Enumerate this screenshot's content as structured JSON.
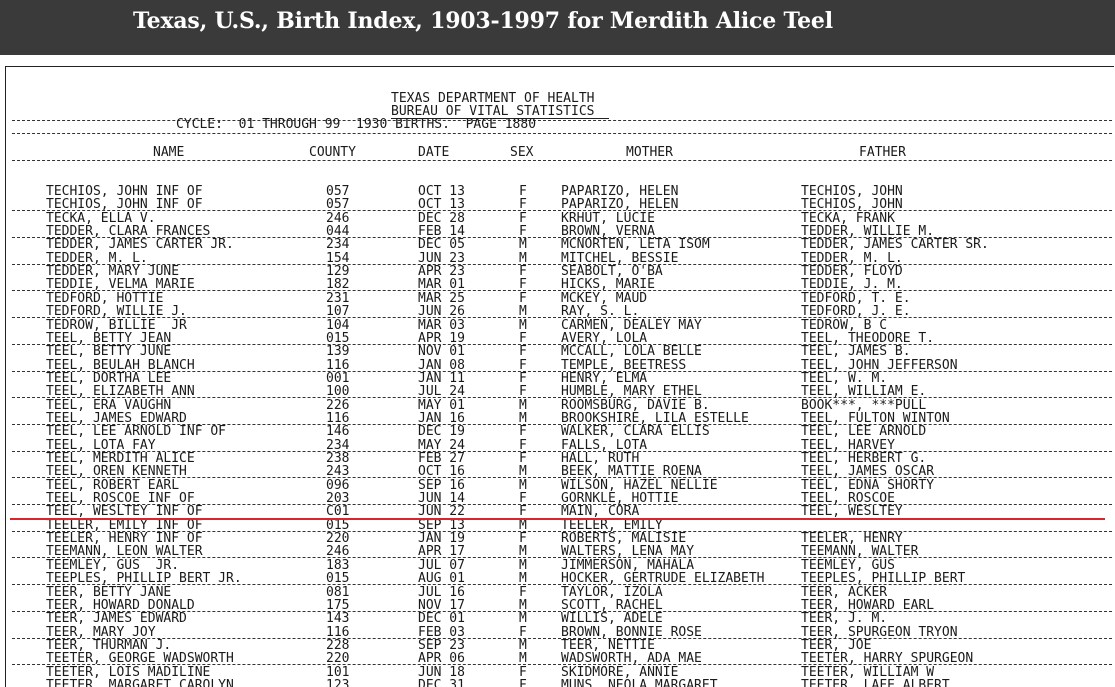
{
  "header": {
    "title": "Texas, U.S., Birth Index, 1903-1997 for Merdith Alice Teel"
  },
  "document": {
    "dept": "TEXAS DEPARTMENT OF HEALTH",
    "bureau": "BUREAU OF VITAL STATISTICS",
    "cycle": "CYCLE:  01 THROUGH 99  1930 BIRTHS.  PAGE 1880",
    "columns": {
      "name": "NAME",
      "county": "COUNTY",
      "date": "DATE",
      "sex": "SEX",
      "mother": "MOTHER",
      "father": "FATHER"
    },
    "highlighted_record": "TEEL, MERDITH ALICE",
    "records": [
      {
        "name": "TECHIOS, JOHN INF OF",
        "county": "057",
        "date": "OCT 13",
        "sex": "F",
        "mother": "PAPARIZO, HELEN",
        "father": "TECHIOS, JOHN"
      },
      {
        "name": "TECHIOS, JOHN INF OF",
        "county": "057",
        "date": "OCT 13",
        "sex": "F",
        "mother": "PAPARIZO, HELEN",
        "father": "TECHIOS, JOHN"
      },
      {
        "name": "TECKA, ELLA V.",
        "county": "246",
        "date": "DEC 28",
        "sex": "F",
        "mother": "KRHUT, LUCIE",
        "father": "TECKA, FRANK"
      },
      {
        "name": "TEDDER, CLARA FRANCES",
        "county": "044",
        "date": "FEB 14",
        "sex": "F",
        "mother": "BROWN, VERNA",
        "father": "TEDDER, WILLIE M."
      },
      {
        "name": "TEDDER, JAMES CARTER JR.",
        "county": "234",
        "date": "DEC 05",
        "sex": "M",
        "mother": "MCNORTEN, LETA ISOM",
        "father": "TEDDER, JAMES CARTER SR."
      },
      {
        "name": "TEDDER, M. L.",
        "county": "154",
        "date": "JUN 23",
        "sex": "M",
        "mother": "MITCHEL, BESSIE",
        "father": "TEDDER, M. L."
      },
      {
        "name": "TEDDER, MARY JUNE",
        "county": "129",
        "date": "APR 23",
        "sex": "F",
        "mother": "SEABOLT, O'BA",
        "father": "TEDDER, FLOYD"
      },
      {
        "name": "TEDDIE, VELMA MARIE",
        "county": "182",
        "date": "MAR 01",
        "sex": "F",
        "mother": "HICKS, MARIE",
        "father": "TEDDIE, J. M."
      },
      {
        "name": "TEDFORD, HOTTIE",
        "county": "231",
        "date": "MAR 25",
        "sex": "F",
        "mother": "MCKEY, MAUD",
        "father": "TEDFORD, T. E."
      },
      {
        "name": "TEDFORD, WILLIE J.",
        "county": "107",
        "date": "JUN 26",
        "sex": "M",
        "mother": "RAY, S. L.",
        "father": "TEDFORD, J. E."
      },
      {
        "name": "TEDROW, BILLIE  JR",
        "county": "104",
        "date": "MAR 03",
        "sex": "M",
        "mother": "CARMEN, DEALEY MAY",
        "father": "TEDROW, B C"
      },
      {
        "name": "TEEL, BETTY JEAN",
        "county": "015",
        "date": "APR 19",
        "sex": "F",
        "mother": "AVERY, LOLA",
        "father": "TEEL, THEODORE T."
      },
      {
        "name": "TEEL, BETTY JUNE",
        "county": "139",
        "date": "NOV 01",
        "sex": "F",
        "mother": "MCCALL, LOLA BELLE",
        "father": "TEEL, JAMES B."
      },
      {
        "name": "TEEL, BEULAH BLANCH",
        "county": "116",
        "date": "JAN 08",
        "sex": "F",
        "mother": "TEMPLE, BEETRESS",
        "father": "TEEL, JOHN JEFFERSON"
      },
      {
        "name": "TEEL, DORTHA LEE",
        "county": "001",
        "date": "JAN 11",
        "sex": "F",
        "mother": "HENRY, ELMA",
        "father": "TEEL, W. M."
      },
      {
        "name": "TEEL, ELIZABETH ANN",
        "county": "100",
        "date": "JUL 24",
        "sex": "F",
        "mother": "HUMBLE, MARY ETHEL",
        "father": "TEEL, WILLIAM E."
      },
      {
        "name": "TEEL, ERA VAUGHN",
        "county": "226",
        "date": "MAY 01",
        "sex": "M",
        "mother": "ROOMSBURG, DAVIE B.",
        "father": "BOOK***, ***PULL"
      },
      {
        "name": "TEEL, JAMES EDWARD",
        "county": "116",
        "date": "JAN 16",
        "sex": "M",
        "mother": "BROOKSHIRE, LILA ESTELLE",
        "father": "TEEL, FULTON WINTON"
      },
      {
        "name": "TEEL, LEE ARNOLD INF OF",
        "county": "146",
        "date": "DEC 19",
        "sex": "F",
        "mother": "WALKER, CLARA ELLIS",
        "father": "TEEL, LEE ARNOLD"
      },
      {
        "name": "TEEL, LOTA FAY",
        "county": "234",
        "date": "MAY 24",
        "sex": "F",
        "mother": "FALLS, LOTA",
        "father": "TEEL, HARVEY"
      },
      {
        "name": "TEEL, MERDITH ALICE",
        "county": "238",
        "date": "FEB 27",
        "sex": "F",
        "mother": "HALL, RUTH",
        "father": "TEEL, HERBERT G."
      },
      {
        "name": "TEEL, OREN KENNETH",
        "county": "243",
        "date": "OCT 16",
        "sex": "M",
        "mother": "BEEK, MATTIE ROENA",
        "father": "TEEL, JAMES OSCAR"
      },
      {
        "name": "TEEL, ROBERT EARL",
        "county": "096",
        "date": "SEP 16",
        "sex": "M",
        "mother": "WILSON, HAZEL NELLIE",
        "father": "TEEL, EDNA SHORTY"
      },
      {
        "name": "TEEL, ROSCOE INF OF",
        "county": "203",
        "date": "JUN 14",
        "sex": "F",
        "mother": "GORNKLE, HOTTIE",
        "father": "TEEL, ROSCOE"
      },
      {
        "name": "TEEL, WESLTEY INF OF",
        "county": "C01",
        "date": "JUN 22",
        "sex": "F",
        "mother": "MAIN, CORA",
        "father": "TEEL, WESLTEY"
      },
      {
        "name": "TEELER, EMILY INF OF",
        "county": "015",
        "date": "SEP 13",
        "sex": "M",
        "mother": "TEELER, EMILY",
        "father": ""
      },
      {
        "name": "TEELER, HENRY INF OF",
        "county": "220",
        "date": "JAN 19",
        "sex": "F",
        "mother": "ROBERTS, MALISIE",
        "father": "TEELER, HENRY"
      },
      {
        "name": "TEEMANN, LEON WALTER",
        "county": "246",
        "date": "APR 17",
        "sex": "M",
        "mother": "WALTERS, LENA MAY",
        "father": "TEEMANN, WALTER"
      },
      {
        "name": "TEEMLEY, GUS  JR.",
        "county": "183",
        "date": "JUL 07",
        "sex": "M",
        "mother": "JIMMERSON, MAHALA",
        "father": "TEEMLEY, GUS"
      },
      {
        "name": "TEEPLES, PHILLIP BERT JR.",
        "county": "015",
        "date": "AUG 01",
        "sex": "M",
        "mother": "HOCKER, GERTRUDE ELIZABETH",
        "father": "TEEPLES, PHILLIP BERT"
      },
      {
        "name": "TEER, BETTY JANE",
        "county": "081",
        "date": "JUL 16",
        "sex": "F",
        "mother": "TAYLOR, IZOLA",
        "father": "TEER, ACKER"
      },
      {
        "name": "TEER, HOWARD DONALD",
        "county": "175",
        "date": "NOV 17",
        "sex": "M",
        "mother": "SCOTT, RACHEL",
        "father": "TEER, HOWARD EARL"
      },
      {
        "name": "TEER, JAMES EDWARD",
        "county": "143",
        "date": "DEC 01",
        "sex": "M",
        "mother": "WILLIS, ADELE",
        "father": "TEER, J. M."
      },
      {
        "name": "TEER, MARY JOY",
        "county": "116",
        "date": "FEB 03",
        "sex": "F",
        "mother": "BROWN, BONNIE ROSE",
        "father": "TEER, SPURGEON TRYON"
      },
      {
        "name": "TEER, THURMAN J.",
        "county": "228",
        "date": "SEP 23",
        "sex": "M",
        "mother": "TEER, NETTIE",
        "father": "TEER, JOE"
      },
      {
        "name": "TEETER, GEORGE WADSWORTH",
        "county": "220",
        "date": "APR 06",
        "sex": "M",
        "mother": "WADSWORTH, ADA MAE",
        "father": "TEETER, HARRY SPURGEON"
      },
      {
        "name": "TEETER, LOIS MADILINE",
        "county": "101",
        "date": "JUN 18",
        "sex": "F",
        "mother": "SKIDMORE, ANNIE",
        "father": "TEETER, WILLIAM W"
      },
      {
        "name": "TEETER, MARGARET CAROLYN",
        "county": "123",
        "date": "DEC 31",
        "sex": "F",
        "mother": "MUNS, NEOLA MARGARET",
        "father": "TEETER, LAFE ALBERT"
      }
    ]
  }
}
